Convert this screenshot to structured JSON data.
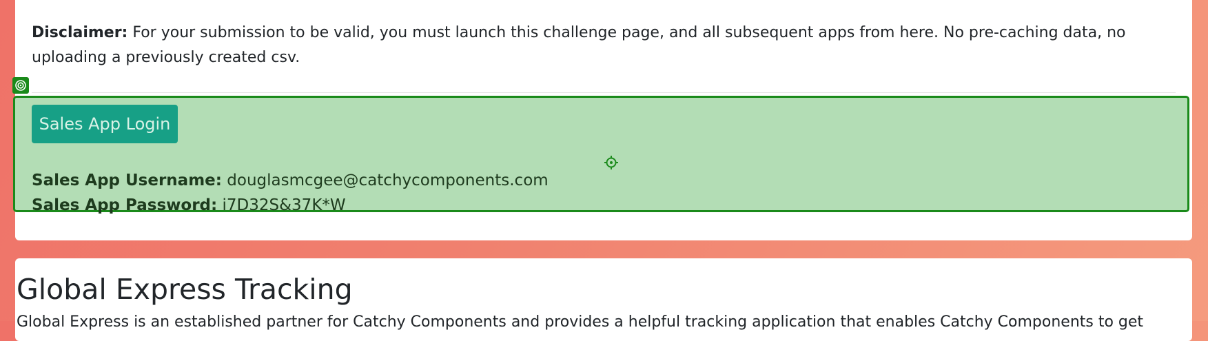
{
  "disclaimer": {
    "label": "Disclaimer:",
    "text": " For your submission to be valid, you must launch this challenge page, and all subsequent apps from here. No pre-caching data, no uploading a previously created csv."
  },
  "sales_app": {
    "login_button_label": "Sales App Login",
    "username_label": "Sales App Username:",
    "username_value": " douglasmcgee@catchycomponents.com",
    "password_label": "Sales App Password:",
    "password_value": " i7D32S&37K*W"
  },
  "global_express": {
    "title": "Global Express Tracking",
    "intro": "Global Express is an established partner for Catchy Components and provides a helpful tracking application that enables Catchy Components to get"
  },
  "overlay": {
    "highlight_color": "#1a8a1a",
    "badge_icon": "target-icon",
    "center_icon": "crosshair-icon"
  }
}
